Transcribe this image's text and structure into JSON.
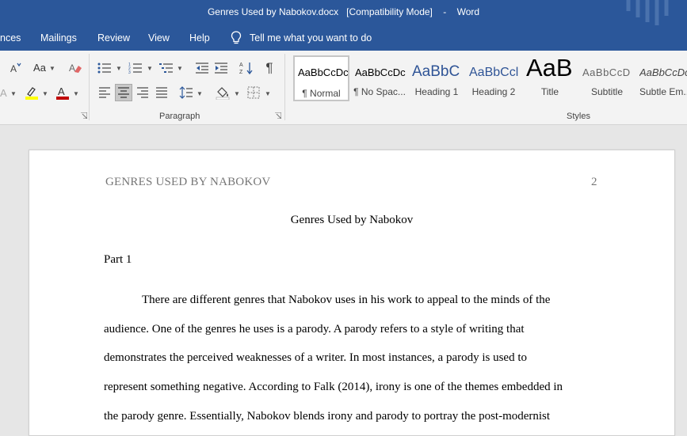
{
  "titlebar": {
    "document_name": "Genres Used by Nabokov.docx",
    "mode": "[Compatibility Mode]",
    "separator": "-",
    "app": "Word"
  },
  "tabs": [
    "nces",
    "Mailings",
    "Review",
    "View",
    "Help"
  ],
  "tell_me": "Tell me what you want to do",
  "ribbon": {
    "font_group": {
      "change_case_label": "Aa"
    },
    "paragraph_group": {
      "label": "Paragraph",
      "pilcrow": "¶"
    },
    "styles_group": {
      "label": "Styles",
      "items": [
        {
          "preview": "AaBbCcDc",
          "name": "¶ Normal"
        },
        {
          "preview": "AaBbCcDc",
          "name": "¶ No Spac..."
        },
        {
          "preview": "AaBbC",
          "name": "Heading 1"
        },
        {
          "preview": "AaBbCcl",
          "name": "Heading 2"
        },
        {
          "preview": "AaB",
          "name": "Title"
        },
        {
          "preview": "AaBbCcD",
          "name": "Subtitle"
        },
        {
          "preview": "AaBbCcDc",
          "name": "Subtle Em..."
        }
      ]
    }
  },
  "colors": {
    "word_blue": "#2b579a",
    "highlight": "#ffff00",
    "font_color": "#c00000"
  },
  "document": {
    "running_head": "GENRES USED BY NABOKOV",
    "page_number": "2",
    "title": "Genres Used by Nabokov",
    "part": "Part 1",
    "lines": [
      "There are different genres that Nabokov uses in his work to appeal to the minds of the",
      "audience. One of the genres he uses is a parody. A parody refers to a style of writing that",
      "demonstrates the perceived weaknesses of a writer. In most instances, a parody is used to",
      "represent something negative. According to Falk (2014), irony is one of the themes embedded in",
      "the parody genre. Essentially, Nabokov blends irony and parody to portray the post-modernist"
    ]
  }
}
